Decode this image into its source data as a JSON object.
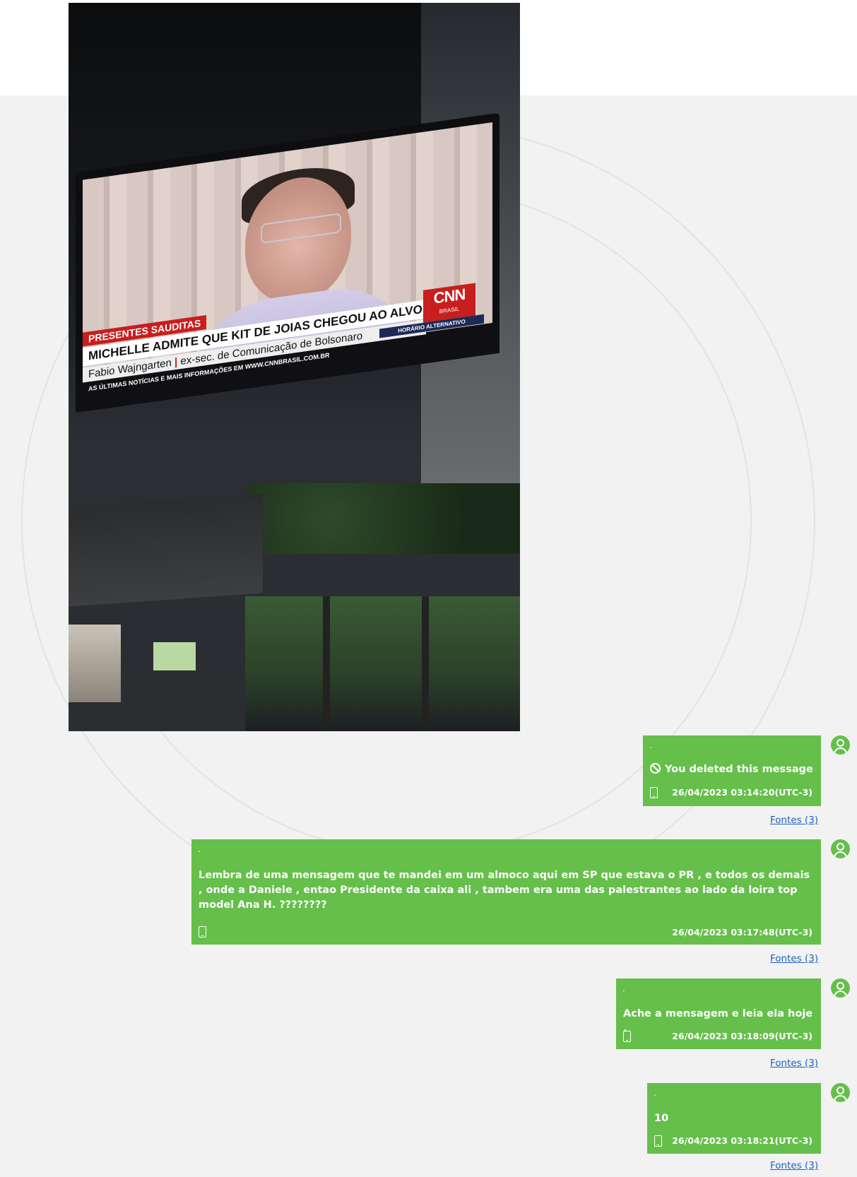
{
  "photo": {
    "tv_lower_third": {
      "tag": "PRESENTES SAUDITAS",
      "headline": "MICHELLE ADMITE QUE KIT DE JOIAS CHEGOU AO ALVORADA",
      "name": "Fabio Wajngarten",
      "separator": "|",
      "role": "ex-sec. de Comunicação de Bolsonaro",
      "ticker": "AS ÚLTIMAS NOTÍCIAS E MAIS INFORMAÇÕES EM WWW.CNNBRASIL.COM.BR",
      "schedule": "HORÁRIO ALTERNATIVO",
      "logo_main": "CNN",
      "logo_sub": "BRASIL"
    }
  },
  "chat": {
    "messages": [
      {
        "marker": ".",
        "text": "You deleted this message",
        "deleted": true,
        "timestamp": "26/04/2023 03:14:20(UTC-3)",
        "sources": "Fontes (3)"
      },
      {
        "marker": ".",
        "text": "Lembra de uma mensagem que te mandei em um almoco aqui em SP que estava o PR ,  e todos os demais , onde a Daniele , entao Presidente da caixa  ali , tambem era uma das palestrantes ao lado da loira top model Ana H.   ????????",
        "timestamp": "26/04/2023 03:17:48(UTC-3)",
        "sources": "Fontes (3)"
      },
      {
        "marker": ".",
        "text": "Ache a mensagem e leia ela hoje .",
        "timestamp": "26/04/2023 03:18:09(UTC-3)",
        "sources": "Fontes (3)"
      },
      {
        "marker": ".",
        "text": "10",
        "timestamp": "26/04/2023 03:18:21(UTC-3)",
        "sources": "Fontes (3)"
      }
    ]
  },
  "colors": {
    "bubble": "#65bf4a",
    "panel": "#f2f2f2",
    "link": "#1e5fbf"
  },
  "icons": [
    "deleted-message-icon",
    "phone-device-icon",
    "user-avatar-icon"
  ]
}
